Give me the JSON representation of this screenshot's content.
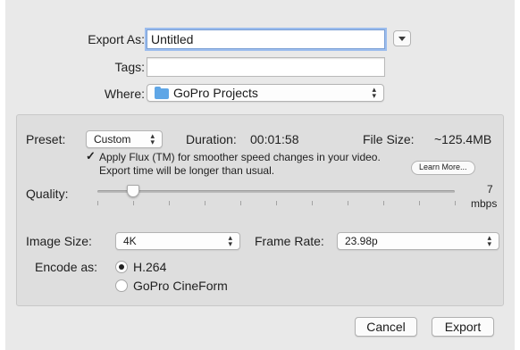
{
  "export_as": {
    "label": "Export As:",
    "value": "Untitled"
  },
  "tags": {
    "label": "Tags:",
    "value": ""
  },
  "where": {
    "label": "Where:",
    "value": "GoPro Projects"
  },
  "preset": {
    "label": "Preset:",
    "value": "Custom"
  },
  "duration": {
    "label": "Duration:",
    "value": "00:01:58"
  },
  "file_size": {
    "label": "File Size:",
    "value": "~125.4MB"
  },
  "flux": {
    "line1": "Apply Flux (TM) for smoother speed changes in your video.",
    "line2": "Export time will be longer than usual.",
    "checked": true,
    "check_glyph": "✓"
  },
  "learn_more": "Learn More...",
  "quality": {
    "label": "Quality:",
    "value": "7",
    "unit": "mbps",
    "level": 0.1
  },
  "image_size": {
    "label": "Image Size:",
    "value": "4K"
  },
  "frame_rate": {
    "label": "Frame Rate:",
    "value": "23.98p"
  },
  "encode": {
    "label": "Encode as:",
    "options": [
      "H.264",
      "GoPro CineForm"
    ],
    "selected": "H.264"
  },
  "buttons": {
    "cancel": "Cancel",
    "export": "Export"
  },
  "icons": {
    "folder": "folder-icon",
    "dropdown": "chevron-down-icon",
    "stepper": "up-down-arrows-icon"
  }
}
